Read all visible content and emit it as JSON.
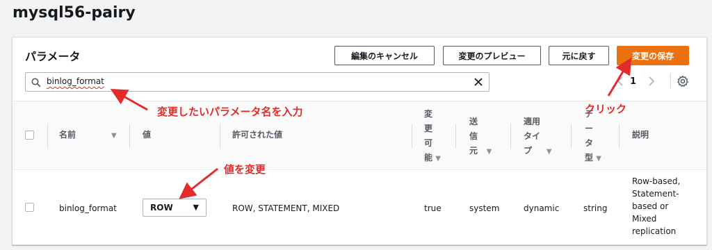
{
  "page": {
    "title": "mysql56-pairy"
  },
  "panel": {
    "title": "パラメータ",
    "buttons": {
      "cancel": "編集のキャンセル",
      "preview": "変更のプレビュー",
      "back": "元に戻す",
      "save": "変更の保存"
    },
    "search": {
      "value": "binlog_format"
    },
    "pager": {
      "page": "1"
    }
  },
  "table": {
    "headers": {
      "name": "名前",
      "value": "値",
      "allowed": "許可された値",
      "modifiable": [
        "変",
        "更",
        "可",
        "能"
      ],
      "source": [
        "送",
        "信",
        "元"
      ],
      "apply_type": [
        "適用",
        "タイ",
        "プ"
      ],
      "data_type": [
        "デ",
        "ー",
        "タ",
        "型"
      ],
      "description": "説明"
    },
    "rows": [
      {
        "name": "binlog_format",
        "value": "ROW",
        "allowed": "ROW, STATEMENT, MIXED",
        "modifiable": "true",
        "source": "system",
        "apply_type": "dynamic",
        "data_type": "string",
        "description": [
          "Row-based,",
          "Statement-",
          "based or",
          "Mixed",
          "replication"
        ]
      }
    ]
  },
  "annotations": {
    "search_note": "変更したいパラメータ名を入力",
    "value_note": "値を変更",
    "click_note": "クリック",
    "color": "#e32b2b"
  },
  "colors": {
    "accent": "#ec7211",
    "background": "#f2f3f3"
  }
}
